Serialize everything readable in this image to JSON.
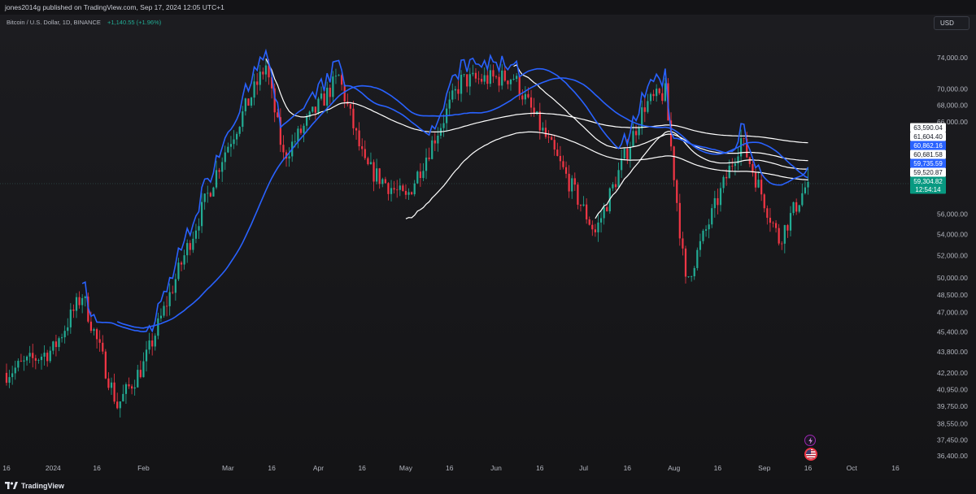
{
  "header": {
    "published": "jones2014g published on TradingView.com, Sep 17, 2024 12:05 UTC+1",
    "symbol": "Bitcoin / U.S. Dollar, 1D, BINANCE",
    "change": "+1,140.55 (+1.96%)",
    "currency_button": "USD"
  },
  "footer": {
    "logo_text": "TradingView",
    "logo_icon": "tradingview-logo-icon"
  },
  "colors": {
    "background": "#161619",
    "up": "#22ab94",
    "down": "#f23645",
    "ma_white": "#ffffff",
    "ma_blue": "#2962ff"
  },
  "icons": [
    "lightning-icon",
    "us-flag-icon"
  ],
  "chart_data": {
    "type": "candlestick",
    "symbol": "Bitcoin / U.S. Dollar",
    "interval": "1D",
    "exchange": "BINANCE",
    "scale": "log",
    "x_labels": [
      "16",
      "2024",
      "16",
      "Feb",
      "Mar",
      "16",
      "Apr",
      "16",
      "May",
      "16",
      "Jun",
      "16",
      "Jul",
      "16",
      "Aug",
      "16",
      "Sep",
      "16",
      "Oct",
      "16"
    ],
    "y_labels": [
      "74,000.00",
      "70,000.00",
      "68,000.00",
      "66,000.00",
      "56,000.00",
      "54,000.00",
      "52,000.00",
      "50,000.00",
      "48,500.00",
      "47,000.00",
      "45,400.00",
      "43,800.00",
      "42,200.00",
      "40,950.00",
      "39,750.00",
      "38,550.00",
      "37,450.00",
      "36,400.00"
    ],
    "price_tags": [
      {
        "text": "63,590.04",
        "color": "#ffffff",
        "text_color": "#131722"
      },
      {
        "text": "61,604.40",
        "color": "#ffffff",
        "text_color": "#131722"
      },
      {
        "text": "60,862.16",
        "color": "#2962ff",
        "text_color": "#ffffff"
      },
      {
        "text": "60,681.58",
        "color": "#ffffff",
        "text_color": "#131722"
      },
      {
        "text": "59,735.59",
        "color": "#2962ff",
        "text_color": "#ffffff"
      },
      {
        "text": "59,520.87",
        "color": "#ffffff",
        "text_color": "#131722"
      },
      {
        "text": "59,304.82",
        "color": "#089981",
        "text_color": "#ffffff"
      },
      {
        "text": "12:54:14",
        "color": "#089981",
        "text_color": "#ffffff"
      }
    ],
    "last_price": 59304.82,
    "countdown": "12:54:14",
    "approx_closes": [
      {
        "date": "2023-12-16",
        "close": 42200
      },
      {
        "date": "2024-01-01",
        "close": 44000
      },
      {
        "date": "2024-01-11",
        "close": 48500
      },
      {
        "date": "2024-01-23",
        "close": 39800
      },
      {
        "date": "2024-02-01",
        "close": 42800
      },
      {
        "date": "2024-02-15",
        "close": 52000
      },
      {
        "date": "2024-02-28",
        "close": 62000
      },
      {
        "date": "2024-03-14",
        "close": 73000
      },
      {
        "date": "2024-03-20",
        "close": 62000
      },
      {
        "date": "2024-04-08",
        "close": 71500
      },
      {
        "date": "2024-04-17",
        "close": 61000
      },
      {
        "date": "2024-05-01",
        "close": 57500
      },
      {
        "date": "2024-05-20",
        "close": 71000
      },
      {
        "date": "2024-06-07",
        "close": 71500
      },
      {
        "date": "2024-06-24",
        "close": 60500
      },
      {
        "date": "2024-07-05",
        "close": 54200
      },
      {
        "date": "2024-07-22",
        "close": 68000
      },
      {
        "date": "2024-07-29",
        "close": 69500
      },
      {
        "date": "2024-08-05",
        "close": 49500
      },
      {
        "date": "2024-08-24",
        "close": 64000
      },
      {
        "date": "2024-09-06",
        "close": 53500
      },
      {
        "date": "2024-09-16",
        "close": 59304.82
      }
    ],
    "moving_averages": [
      {
        "color": "#ffffff",
        "last": 63590.04
      },
      {
        "color": "#ffffff",
        "last": 61604.4
      },
      {
        "color": "#ffffff",
        "last": 60681.58
      },
      {
        "color": "#ffffff",
        "last": 59520.87
      },
      {
        "color": "#2962ff",
        "last": 60862.16
      },
      {
        "color": "#2962ff",
        "last": 59735.59
      }
    ],
    "grid": false
  }
}
